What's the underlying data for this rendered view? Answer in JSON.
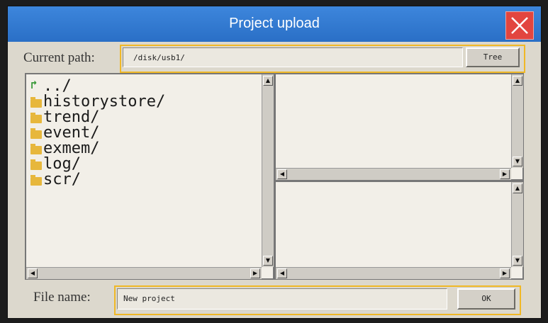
{
  "dialog": {
    "title": "Project upload"
  },
  "path": {
    "label": "Current path:",
    "value": "/disk/usb1/",
    "tree_button": "Tree"
  },
  "files": [
    {
      "name": "../",
      "type": "parent"
    },
    {
      "name": "historystore/",
      "type": "folder"
    },
    {
      "name": "trend/",
      "type": "folder"
    },
    {
      "name": "event/",
      "type": "folder"
    },
    {
      "name": "exmem/",
      "type": "folder"
    },
    {
      "name": "log/",
      "type": "folder"
    },
    {
      "name": "scr/",
      "type": "folder"
    }
  ],
  "filename": {
    "label": "File name:",
    "value": "New project",
    "ok_button": "OK"
  },
  "colors": {
    "titlebar": "#2f78d2",
    "close": "#e2453f",
    "highlight": "#f0b826",
    "panel": "#f2efe8"
  },
  "icons": {
    "close": "close-icon",
    "folder": "folder-icon",
    "parent": "up-arrow-icon"
  }
}
